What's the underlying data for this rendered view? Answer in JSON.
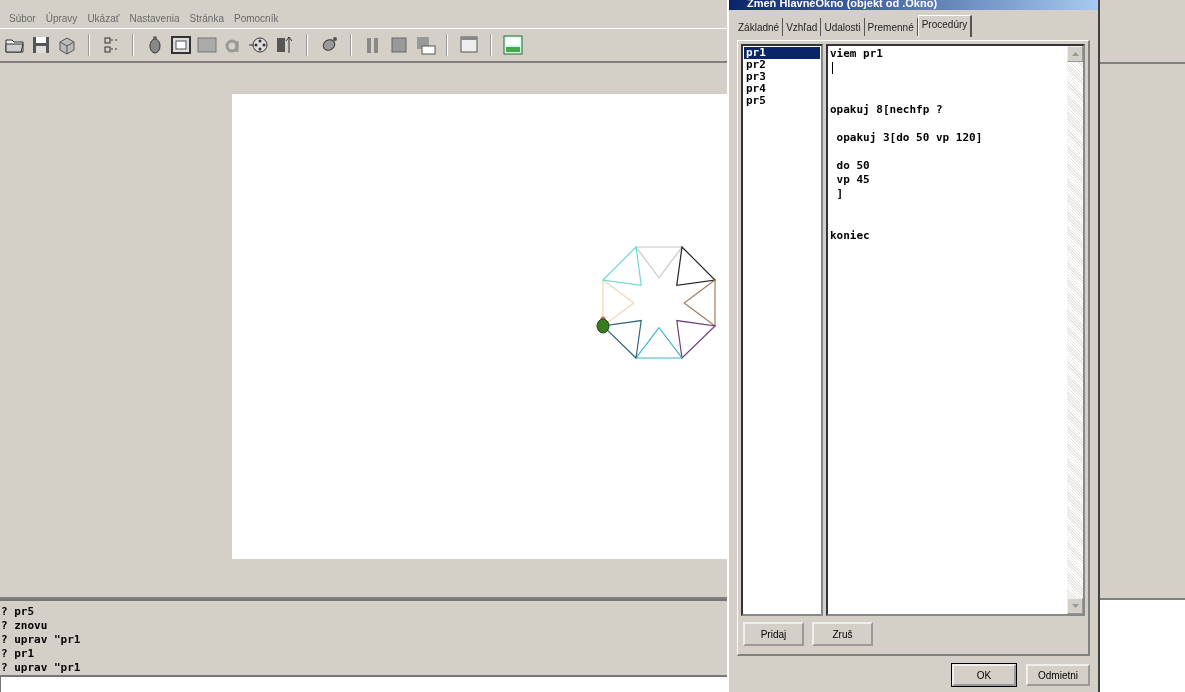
{
  "menu": [
    "Súbor",
    "Úpravy",
    "Ukázať",
    "Nastavenia",
    "Stránka",
    "Pomocník"
  ],
  "console": {
    "lines": [
      "? pr5",
      "? znovu",
      "? uprav \"pr1",
      "? pr1",
      "? uprav \"pr1"
    ]
  },
  "dialog": {
    "title": "Zmeň HlavnéOkno (objekt od .Okno)",
    "tabs": [
      {
        "label": "Základné",
        "selected": false
      },
      {
        "label": "Vzhľad",
        "selected": false
      },
      {
        "label": "Udalosti",
        "selected": false
      },
      {
        "label": "Premenné",
        "selected": false
      },
      {
        "label": "Procedúry",
        "selected": true
      }
    ],
    "procedures": [
      {
        "label": "pr1",
        "selected": true
      },
      {
        "label": "pr2",
        "selected": false
      },
      {
        "label": "pr3",
        "selected": false
      },
      {
        "label": "pr4",
        "selected": false
      },
      {
        "label": "pr5",
        "selected": false
      }
    ],
    "code": "viem pr1\n\n\n\nopakuj 8[nechfp ?\n\n opakuj 3[do 50 vp 120]\n\n do 50\n vp 45\n ]\n\n\nkoniec",
    "list_buttons": [
      "Pridaj",
      "Zruš"
    ],
    "buttons": [
      "OK",
      "Odmietni"
    ]
  }
}
